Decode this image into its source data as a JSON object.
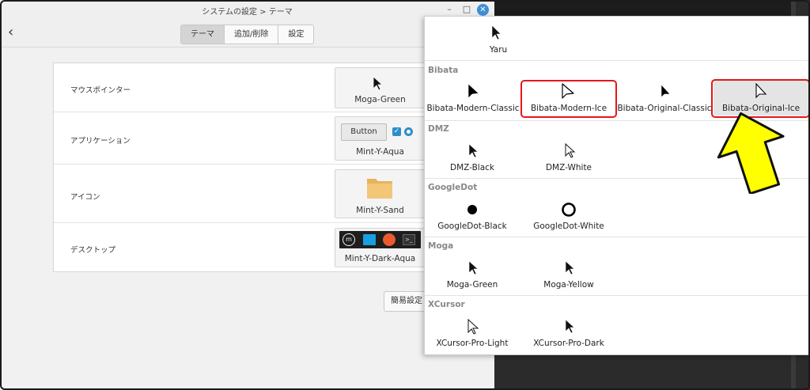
{
  "window": {
    "title": "システムの設定 > テーマ",
    "back_icon": "‹",
    "minimize_icon": "–",
    "maximize_icon": "□",
    "close_icon": "✕"
  },
  "tabs": [
    {
      "label": "テーマ",
      "active": true
    },
    {
      "label": "追加/削除",
      "active": false
    },
    {
      "label": "設定",
      "active": false
    }
  ],
  "settings": [
    {
      "label": "マウスポインター",
      "value": "Moga-Green"
    },
    {
      "label": "アプリケーション",
      "value": "Mint-Y-Aqua",
      "preview_button": "Button"
    },
    {
      "label": "アイコン",
      "value": "Mint-Y-Sand"
    },
    {
      "label": "デスクトップ",
      "value": "Mint-Y-Dark-Aqua"
    }
  ],
  "simple_settings_label": "簡易設定",
  "cursor_popover": {
    "yaru": "Yaru",
    "sections": [
      {
        "title": "Bibata",
        "items": [
          "Bibata-Modern-Classic",
          "Bibata-Modern-Ice",
          "Bibata-Original-Classic",
          "Bibata-Original-Ice"
        ]
      },
      {
        "title": "DMZ",
        "items": [
          "DMZ-Black",
          "DMZ-White"
        ]
      },
      {
        "title": "GoogleDot",
        "items": [
          "GoogleDot-Black",
          "GoogleDot-White"
        ]
      },
      {
        "title": "Moga",
        "items": [
          "Moga-Green",
          "Moga-Yellow"
        ]
      },
      {
        "title": "XCursor",
        "items": [
          "XCursor-Pro-Light",
          "XCursor-Pro-Dark"
        ]
      }
    ],
    "selected": "Bibata-Original-Ice",
    "highlighted": [
      "Bibata-Modern-Ice",
      "Bibata-Original-Ice"
    ]
  },
  "colors": {
    "highlight_box": "#e3171b",
    "annotation_arrow": "#ffff00",
    "accent": "#3d8fd6"
  }
}
